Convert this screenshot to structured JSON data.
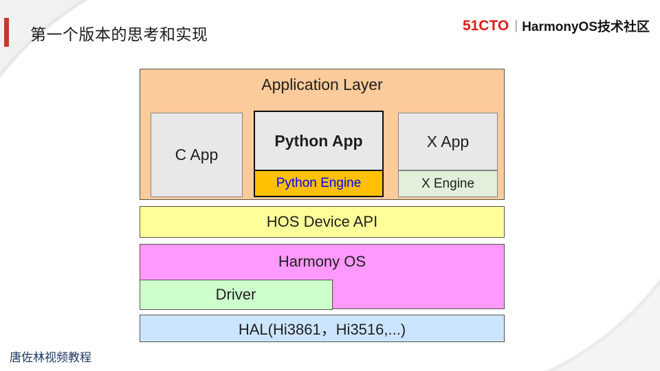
{
  "slide": {
    "title": "第一个版本的思考和实现",
    "footer_credit": "唐佐林视频教程",
    "accent_color": "#C23A2B",
    "footer_color": "#1F3864"
  },
  "logo": {
    "brand": "51CTO",
    "separator": "|",
    "community": "HarmonyOS技术社区",
    "brand_color": "#DC1E17"
  },
  "diagram": {
    "application_layer": {
      "label": "Application Layer",
      "fill": "#FBCB9B"
    },
    "c_app": {
      "label": "C App",
      "fill": "#E8E8E8"
    },
    "python_app": {
      "label": "Python App",
      "fill": "#E8E8E8"
    },
    "python_engine": {
      "label": "Python Engine",
      "fill": "#FFC000",
      "text_color": "#0000FF"
    },
    "x_app": {
      "label": "X App",
      "fill": "#E8E8E8"
    },
    "x_engine": {
      "label": "X Engine",
      "fill": "#E2EFDA"
    },
    "hos_device_api": {
      "label": "HOS Device API",
      "fill": "#FFFF99"
    },
    "harmony_os": {
      "label": "Harmony OS",
      "fill": "#FF99FF"
    },
    "driver": {
      "label": "Driver",
      "fill": "#CCFFCC"
    },
    "hal": {
      "label": "HAL(Hi3861，Hi3516,...)",
      "fill": "#CCE5FF"
    }
  }
}
